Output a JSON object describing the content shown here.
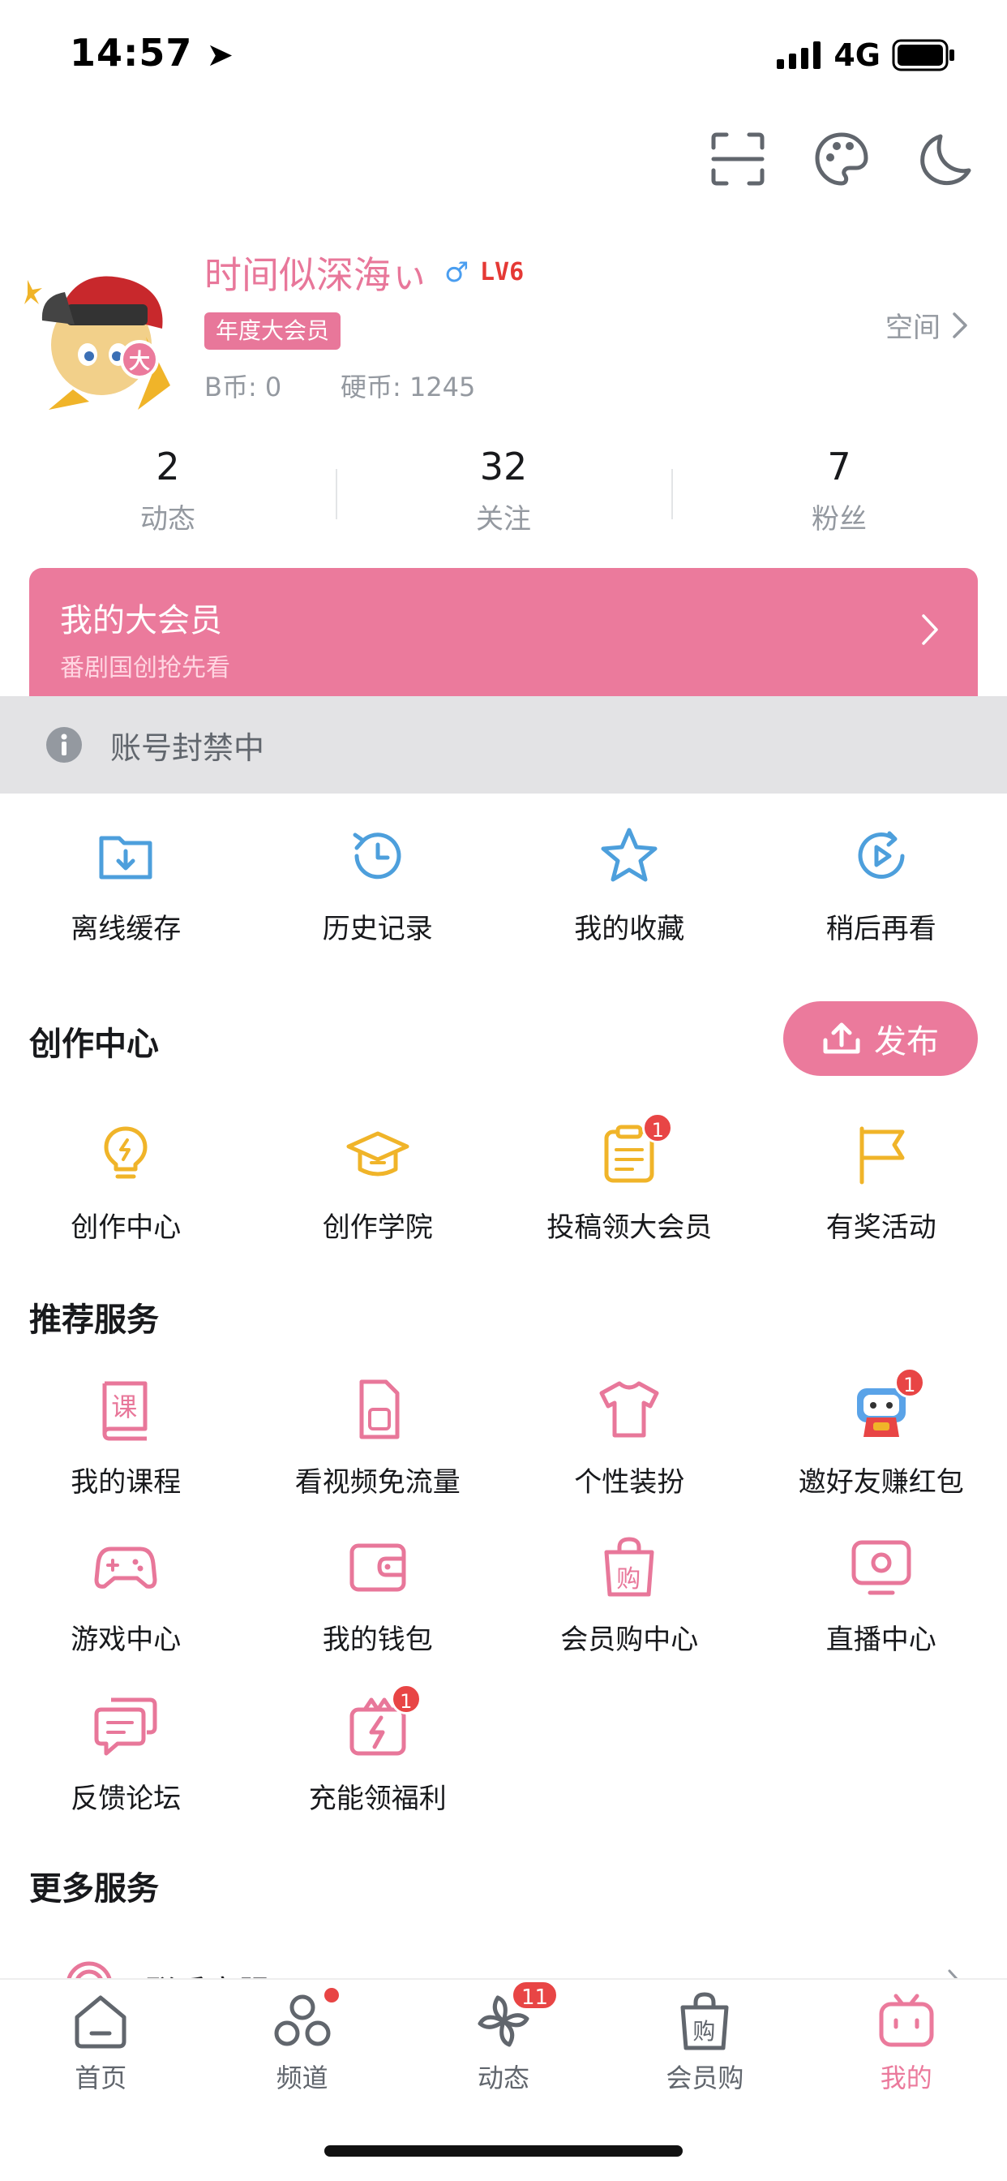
{
  "status_bar": {
    "time": "14:57",
    "network": "4G"
  },
  "profile": {
    "username": "时间似深海ぃ",
    "gender_symbol": "♂",
    "level": "LV6",
    "vip_badge": "年度大会员",
    "avatar_badge": "大",
    "bcoin": "B币: 0",
    "hardcoin": "硬币: 1245",
    "space_link": "空间"
  },
  "stats": [
    {
      "value": "2",
      "label": "动态"
    },
    {
      "value": "32",
      "label": "关注"
    },
    {
      "value": "7",
      "label": "粉丝"
    }
  ],
  "vip_banner": {
    "title": "我的大会员",
    "subtitle": "番剧国创抢先看"
  },
  "banned_notice": "账号封禁中",
  "quick_items": [
    {
      "label": "离线缓存",
      "icon": "download-folder-icon"
    },
    {
      "label": "历史记录",
      "icon": "history-clock-icon"
    },
    {
      "label": "我的收藏",
      "icon": "star-icon"
    },
    {
      "label": "稍后再看",
      "icon": "watch-later-icon"
    }
  ],
  "creation": {
    "title": "创作中心",
    "publish_label": "发布",
    "items": [
      {
        "label": "创作中心",
        "icon": "lightbulb-icon"
      },
      {
        "label": "创作学院",
        "icon": "graduation-cap-icon"
      },
      {
        "label": "投稿领大会员",
        "icon": "clipboard-icon",
        "badge": "1"
      },
      {
        "label": "有奖活动",
        "icon": "flag-icon"
      }
    ]
  },
  "recommended": {
    "title": "推荐服务",
    "items": [
      {
        "label": "我的课程",
        "icon": "course-book-icon",
        "glyph": "课"
      },
      {
        "label": "看视频免流量",
        "icon": "sim-card-icon"
      },
      {
        "label": "个性装扮",
        "icon": "tshirt-icon"
      },
      {
        "label": "邀好友赚红包",
        "icon": "invite-mascot-icon",
        "badge": "1"
      },
      {
        "label": "游戏中心",
        "icon": "gamepad-icon"
      },
      {
        "label": "我的钱包",
        "icon": "wallet-icon"
      },
      {
        "label": "会员购中心",
        "icon": "shopping-bag-icon",
        "glyph": "购"
      },
      {
        "label": "直播中心",
        "icon": "live-tv-icon"
      },
      {
        "label": "反馈论坛",
        "icon": "chat-bubbles-icon"
      },
      {
        "label": "充能领福利",
        "icon": "gift-charge-icon",
        "badge": "1"
      }
    ]
  },
  "more": {
    "title": "更多服务",
    "partial_item": "联系客服"
  },
  "tabbar": [
    {
      "label": "首页",
      "icon": "home-icon"
    },
    {
      "label": "频道",
      "icon": "channel-icon",
      "dot": true
    },
    {
      "label": "动态",
      "icon": "pinwheel-icon",
      "badge": "11"
    },
    {
      "label": "会员购",
      "icon": "shop-bag-icon",
      "glyph": "购"
    },
    {
      "label": "我的",
      "icon": "tv-mine-icon",
      "active": true
    }
  ],
  "colors": {
    "pink": "#eb7a9c",
    "blue": "#4d9fdc",
    "yellow": "#f0b429",
    "gray": "#9499a0",
    "badge_red": "#e84545"
  }
}
